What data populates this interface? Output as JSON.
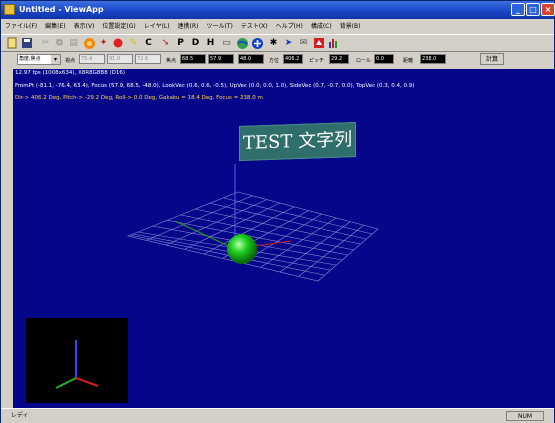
{
  "window": {
    "title": "Untitled - ViewApp",
    "controls": {
      "minimize": "_",
      "maximize": "□",
      "close": "×"
    }
  },
  "menu": [
    "ファイル(F)",
    "編集(E)",
    "表示(V)",
    "位置設定(G)",
    "レイヤ(L)",
    "連携(R)",
    "ツール(T)",
    "テスト(X)",
    "ヘルプ(H)",
    "構成(C)",
    "背景(B)"
  ],
  "toolbar": {
    "letters": [
      "C",
      "P",
      "D",
      "H"
    ],
    "icons": [
      "new-file-icon",
      "save-icon",
      "cut-icon",
      "copy-icon",
      "paste-icon",
      "orange-circle-icon",
      "pin-icon",
      "red-dot-icon",
      "pencil-icon",
      "c-letter-icon",
      "arrow-icon",
      "p-letter-icon",
      "d-letter-icon",
      "h-letter-icon",
      "tv-icon",
      "globe-icon",
      "plus-circle-icon",
      "star-icon",
      "pointer-icon",
      "envelope-icon",
      "red-square-icon",
      "bar-chart-icon"
    ]
  },
  "params": {
    "mode_select": "角度,焦点",
    "viewpoint_label": "視点",
    "viewpoint": [
      "75.4",
      "91.0",
      "72.6"
    ],
    "focus_label": "焦点",
    "focus": [
      "68.5",
      "57.9",
      "48.0"
    ],
    "azimuth_label": "方位",
    "azimuth": "406.2",
    "pitch_label": "ピッチ",
    "pitch": "29.2",
    "roll_label": "ロール",
    "roll": "0.0",
    "distance_label": "距離",
    "distance": "238.0",
    "calc_button": "計算"
  },
  "viewport": {
    "fps_line": "12.97 fps (1008x634), X8R8G8B8 (D16)",
    "from_line": "FromPt (-81.1, -76.4, 63.4), Focus (57.9, 68.5, -48.0), LookVec (0.6, 0.6, -0.5), UpVec (0.0, 0.0, 1.0), SideVec (0.7, -0.7, 0.0), TopVec (0.3, 0.4, 0.9)",
    "dir_line": "Dir-> 406.2 Deg, Pitch-> -29.2 Deg, Roll-> 0.0 Deg, Gakaku = 18.4 Deg, Focus = 238.0 m",
    "label_text": "TEST 文字列",
    "bottom_text": "-----",
    "background": "#06068a",
    "grid_color": "#8a8ad8",
    "sphere_color": "#1fcf1f"
  },
  "status": {
    "left": "レディ",
    "right": "NUM"
  }
}
